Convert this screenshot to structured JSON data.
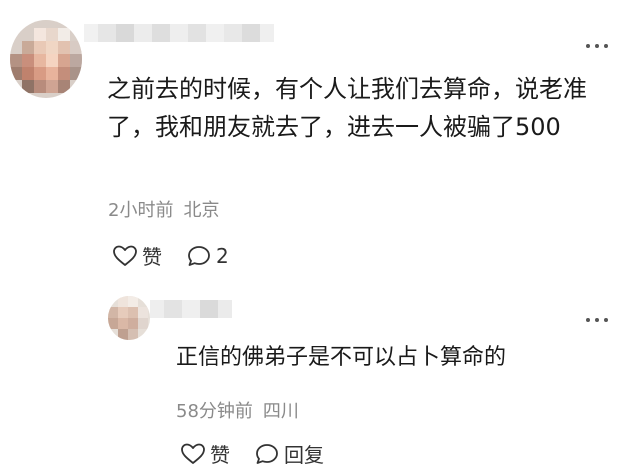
{
  "comment": {
    "text": "之前去的时候，有个人让我们去算命，说老准了，我和朋友就去了，进去一人被骗了500",
    "time": "2小时前",
    "location": "北京",
    "like_label": "赞",
    "reply_count": "2",
    "more_label": "⋮⋮"
  },
  "reply": {
    "text": "正信的佛弟子是不可以占卜算命的",
    "time": "58分钟前",
    "location": "四川",
    "like_label": "赞",
    "reply_label": "回复"
  },
  "colors": {
    "text": "#1a1a1a",
    "meta": "#8a8a8a",
    "icon": "#333333"
  },
  "icons": {
    "like": "heart-outline-icon",
    "comment": "speech-bubble-icon",
    "more": "more-dots-icon"
  }
}
